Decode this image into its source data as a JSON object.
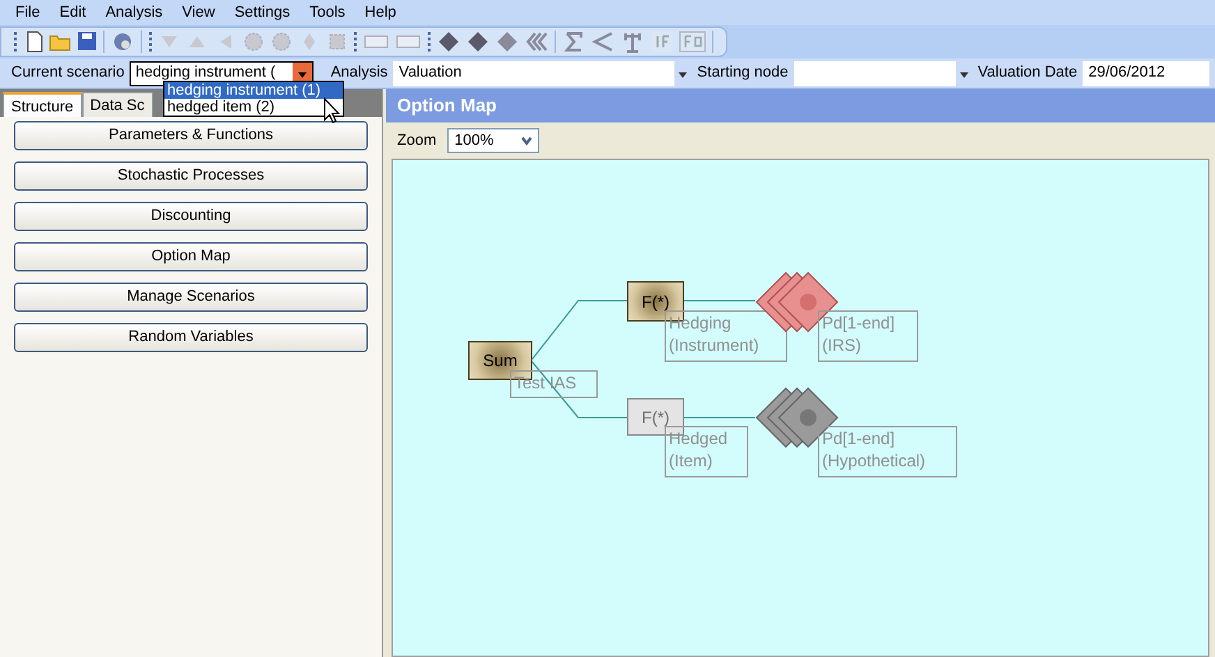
{
  "menu": [
    "File",
    "Edit",
    "Analysis",
    "View",
    "Settings",
    "Tools",
    "Help"
  ],
  "scenario_bar": {
    "scenario_label": "Current scenario",
    "scenario_value": "hedging instrument (",
    "scenario_options": [
      {
        "label": "hedging instrument (1)",
        "selected": true
      },
      {
        "label": "hedged item (2)",
        "selected": false
      }
    ],
    "analysis_label": "Analysis",
    "analysis_value": "Valuation",
    "starting_node_label": "Starting node",
    "valuation_date_label": "Valuation Date",
    "valuation_date": "29/06/2012"
  },
  "tabs": [
    {
      "label": "Structure",
      "selected": true
    },
    {
      "label": "Data Sc",
      "selected": false
    }
  ],
  "sidebar_buttons": [
    "Parameters & Functions",
    "Stochastic Processes",
    "Discounting",
    "Option Map",
    "Manage Scenarios",
    "Random Variables"
  ],
  "panel": {
    "title": "Option Map",
    "zoom_label": "Zoom",
    "zoom_value": "100%"
  },
  "diagram": {
    "nodes": [
      {
        "kind": "sum",
        "text": "Sum",
        "label": "Test IAS",
        "active": true
      },
      {
        "kind": "function",
        "text": "F(*)",
        "label": "Hedging (Instrument)",
        "active": true
      },
      {
        "kind": "payoff",
        "label": "Pd[1-end] (IRS)",
        "active": true
      },
      {
        "kind": "function",
        "text": "F(*)",
        "label": "Hedged (Item)",
        "active": false
      },
      {
        "kind": "payoff",
        "label": "Pd[1-end] (Hypothetical)",
        "active": false
      }
    ]
  }
}
